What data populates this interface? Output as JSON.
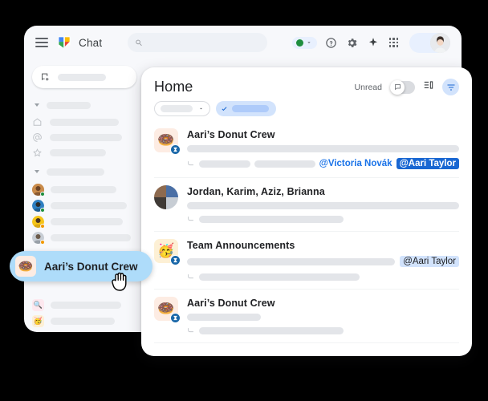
{
  "app": {
    "brand": "Chat",
    "logo_icon": "google-chat-logo",
    "menu_icon": "hamburger-menu-icon"
  },
  "search": {
    "icon": "search-icon",
    "value": "",
    "placeholder": ""
  },
  "topbar_actions": [
    {
      "name": "status-indicator",
      "icon": "green-status-dot",
      "color": "#1e8e3e"
    },
    {
      "name": "status-chevron",
      "icon": "chevron-down-icon"
    },
    {
      "name": "help",
      "icon": "help-circle-icon"
    },
    {
      "name": "settings",
      "icon": "gear-icon"
    },
    {
      "name": "gemini",
      "icon": "spark-icon"
    },
    {
      "name": "apps",
      "icon": "apps-grid-icon"
    },
    {
      "name": "account",
      "icon": "avatar"
    }
  ],
  "sidebar": {
    "compose": {
      "label": "",
      "icon": "new-chat-icon"
    },
    "sections": [
      {
        "type": "section-header",
        "label": ""
      },
      {
        "type": "nav",
        "icon": "home-icon",
        "label": ""
      },
      {
        "type": "nav",
        "icon": "mentions-at-icon",
        "label": ""
      },
      {
        "type": "nav",
        "icon": "star-icon",
        "label": ""
      },
      {
        "type": "section-header",
        "label": ""
      },
      {
        "type": "dm",
        "presence": "#1e8e3e",
        "label": "",
        "avatar": "#c98b4b"
      },
      {
        "type": "dm",
        "presence": "#1e8e3e",
        "label": "",
        "avatar": "#2f7fc1"
      },
      {
        "type": "dm",
        "presence": "#f29900",
        "label": "",
        "avatar": "#f5c518"
      },
      {
        "type": "dm",
        "presence": "#f29900",
        "label": "",
        "avatar": "#9aa0a6"
      },
      {
        "type": "section-header",
        "label": ""
      },
      {
        "type": "space",
        "emoji": "🔍",
        "label": "",
        "bg": "#fde8ef"
      },
      {
        "type": "space",
        "emoji": "🥳",
        "label": "",
        "bg": "#fdf0d5"
      }
    ]
  },
  "main": {
    "title": "Home",
    "unread_label": "Unread",
    "unread_on": false,
    "toggle_icon": "chat-bubble-icon",
    "density_icon": "list-density-icon",
    "filter_icon": "filter-icon",
    "filter_accent": "#d2e3fc",
    "chips": [
      {
        "name": "chip-dropdown",
        "label": "",
        "icon": "chevron-down-icon",
        "selected": false
      },
      {
        "name": "chip-selected",
        "label": "",
        "icon": "check-icon",
        "selected": true
      }
    ],
    "conversations": [
      {
        "title": "Aari’s Donut Crew",
        "avatar_type": "emoji",
        "emoji": "🍩",
        "avatar_bg": "#fdece3",
        "badge_icon": "space-badge-icon",
        "mentions": [
          {
            "text": "@Victoria Novák",
            "style": "plain-blue"
          },
          {
            "text": "@Aari Taylor",
            "style": "dark-chip"
          }
        ]
      },
      {
        "title": "Jordan, Karim, Aziz, Brianna",
        "avatar_type": "mosaic",
        "mosaic_colors": [
          "#8d6a4f",
          "#4a6fa5",
          "#3f3a36",
          "#c7cdd4"
        ],
        "mentions": []
      },
      {
        "title": "Team Announcements",
        "avatar_type": "emoji",
        "emoji": "🥳",
        "avatar_bg": "#fdf0d5",
        "badge_icon": "space-badge-icon",
        "mentions": [
          {
            "text": "@Aari Taylor",
            "style": "light-chip"
          }
        ]
      },
      {
        "title": "Aari’s Donut Crew",
        "avatar_type": "emoji",
        "emoji": "🍩",
        "avatar_bg": "#fdece3",
        "badge_icon": "space-badge-icon",
        "mentions": []
      }
    ]
  },
  "drag": {
    "label": "Aari’s Donut Crew",
    "emoji": "🍩",
    "emoji_bg": "#fdece3",
    "pill_color": "#aedcfa",
    "cursor": "grabbing-hand-cursor"
  }
}
